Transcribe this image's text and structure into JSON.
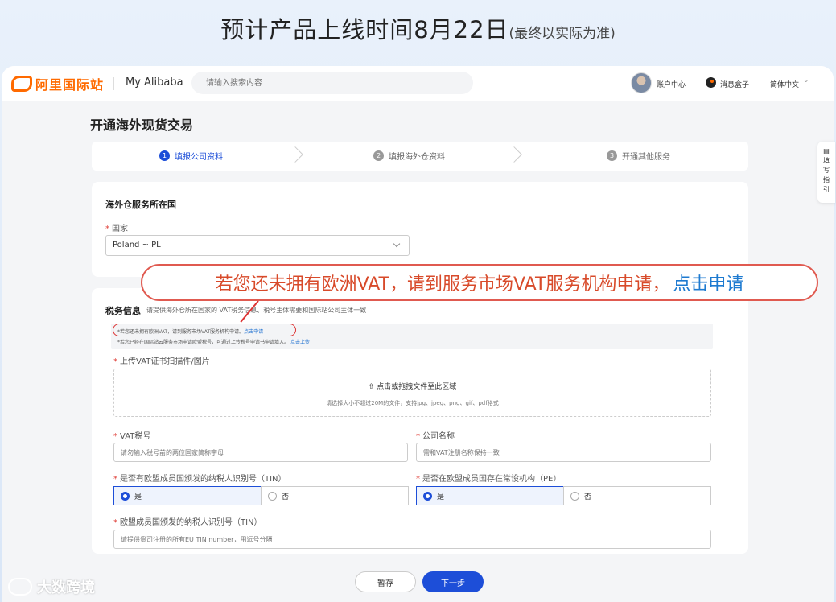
{
  "announcement": {
    "main": "预计产品上线时间8月22日",
    "note": "(最终以实际为准)"
  },
  "header": {
    "logo_text": "阿里国际站",
    "my_alibaba": "My Alibaba",
    "search_placeholder": "请输入搜索内容",
    "account_center": "账户中心",
    "message_box": "消息盒子",
    "language": "简体中文"
  },
  "page": {
    "title": "开通海外现货交易",
    "steps": [
      {
        "num": "1",
        "label": "填报公司资料",
        "active": true
      },
      {
        "num": "2",
        "label": "填报海外仓资料",
        "active": false
      },
      {
        "num": "3",
        "label": "开通其他服务",
        "active": false
      }
    ]
  },
  "warehouse": {
    "heading": "海外仓服务所在国",
    "country_label": "国家",
    "country_value": "Poland ~ PL"
  },
  "tax": {
    "title": "税务信息",
    "desc": "请提供海外仓所在国家的 VAT税务信息、税号主体需要和国际站公司主体一致",
    "notice_line1": "*若您还未拥有欧洲VAT，请到服务市场VAT服务机构申请。",
    "notice_link1": "点击申请",
    "notice_line2": "*若您已经在国际站云服务市场申请欧盟税号，可通过上传税号申请书申请填入。",
    "notice_link2": "点击上传",
    "upload_label": "上传VAT证书扫描件/图片",
    "upload_main": "点击或拖拽文件至此区域",
    "upload_hint": "请选择大小不超过20M的文件，支持jpg、jpeg、png、gif、pdf格式",
    "vat_label": "VAT税号",
    "vat_placeholder": "请勿输入税号前的两位国家简称字母",
    "company_label": "公司名称",
    "company_placeholder": "需和VAT注册名称保持一致",
    "tin_question": "是否有欧盟成员国颁发的纳税人识别号（TIN）",
    "pe_question": "是否在欧盟成员国存在常设机构（PE）",
    "yes": "是",
    "no": "否",
    "eu_tin_label": "欧盟成员国颁发的纳税人识别号（TIN）",
    "eu_tin_placeholder": "请提供贵司注册的所有EU TIN number，用逗号分隔"
  },
  "callout": {
    "text": "若您还未拥有欧洲VAT，请到服务市场VAT服务机构申请，",
    "link": "点击申请"
  },
  "side_tab": "填写指引",
  "buttons": {
    "save": "暂存",
    "next": "下一步"
  },
  "watermark": "大数跨境"
}
